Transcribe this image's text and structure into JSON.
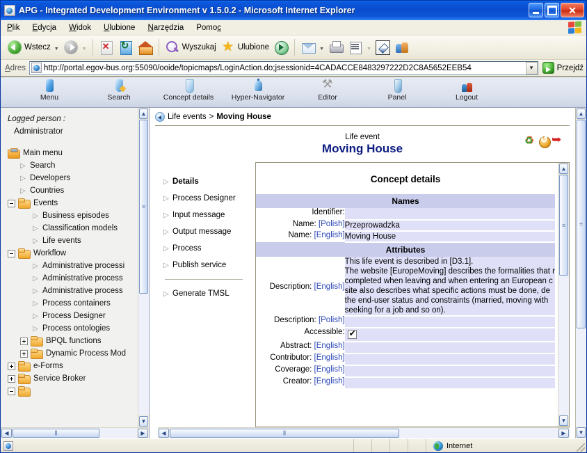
{
  "window": {
    "title": "APG - Integrated Development Environment v 1.5.0.2 - Microsoft Internet Explorer",
    "minimize_label": "Minimize",
    "maximize_label": "Maximize",
    "close_label": "Close"
  },
  "menubar": {
    "items": [
      {
        "label": "Plik",
        "accel": "P"
      },
      {
        "label": "Edycja",
        "accel": "E"
      },
      {
        "label": "Widok",
        "accel": "W"
      },
      {
        "label": "Ulubione",
        "accel": "U"
      },
      {
        "label": "Narzędzia",
        "accel": "N"
      },
      {
        "label": "Pomoc",
        "accel": "c"
      }
    ]
  },
  "toolbar": {
    "back_label": "Wstecz",
    "forward_label": "",
    "stop_label": "",
    "refresh_label": "",
    "home_label": "",
    "search_label": "Wyszukaj",
    "favorites_label": "Ulubione",
    "media_label": "",
    "mail_label": "",
    "print_label": "",
    "edit_label": "",
    "discuss_label": "",
    "messenger_label": ""
  },
  "address": {
    "label": "Adres",
    "url": "http://portal.egov-bus.org:55090/ooide/topicmaps/LoginAction.do;jsessionid=4CADACCE8483297222D2C8A5652EEB54",
    "go_label": "Przejdź"
  },
  "appnav": {
    "items": [
      {
        "label": "Menu",
        "icon": "menu-icon"
      },
      {
        "label": "Search",
        "icon": "search-icon"
      },
      {
        "label": "Concept details",
        "icon": "concept-details-icon"
      },
      {
        "label": "Hyper-Navigator",
        "icon": "hyper-navigator-icon"
      },
      {
        "label": "Editor",
        "icon": "editor-icon"
      },
      {
        "label": "Panel",
        "icon": "panel-icon"
      },
      {
        "label": "Logout",
        "icon": "logout-icon"
      }
    ]
  },
  "sidebar": {
    "logged_label": "Logged person :",
    "logged_user": "Administrator",
    "root": "Main menu",
    "tree": [
      {
        "label": "Search",
        "level": 2,
        "type": "leaf"
      },
      {
        "label": "Developers",
        "level": 2,
        "type": "leaf"
      },
      {
        "label": "Countries",
        "level": 2,
        "type": "leaf"
      },
      {
        "label": "Events",
        "level": 1,
        "type": "folder",
        "state": "expanded"
      },
      {
        "label": "Business episodes",
        "level": 3,
        "type": "leaf"
      },
      {
        "label": "Classification models",
        "level": 3,
        "type": "leaf"
      },
      {
        "label": "Life events",
        "level": 3,
        "type": "leaf"
      },
      {
        "label": "Workflow",
        "level": 1,
        "type": "folder",
        "state": "expanded"
      },
      {
        "label": "Administrative processi",
        "level": 3,
        "type": "leaf"
      },
      {
        "label": "Administrative process",
        "level": 3,
        "type": "leaf"
      },
      {
        "label": "Administrative process",
        "level": 3,
        "type": "leaf"
      },
      {
        "label": "Process containers",
        "level": 3,
        "type": "leaf"
      },
      {
        "label": "Process Designer",
        "level": 3,
        "type": "leaf"
      },
      {
        "label": "Process ontologies",
        "level": 3,
        "type": "leaf"
      },
      {
        "label": "BPQL functions",
        "level": 2,
        "type": "folder",
        "state": "collapsed"
      },
      {
        "label": "Dynamic Process Mod",
        "level": 2,
        "type": "folder",
        "state": "collapsed"
      },
      {
        "label": "e-Forms",
        "level": 1,
        "type": "folder",
        "state": "collapsed"
      },
      {
        "label": "Service Broker",
        "level": 1,
        "type": "folder",
        "state": "collapsed"
      }
    ]
  },
  "breadcrumb": {
    "parent": "Life events",
    "separator": ">",
    "current": "Moving House"
  },
  "page_title": {
    "subtitle": "Life event",
    "title": "Moving House",
    "actions": [
      {
        "name": "refresh-action-icon"
      },
      {
        "name": "history-action-icon"
      },
      {
        "name": "go-action-icon"
      }
    ]
  },
  "submenu": {
    "items": [
      {
        "label": "Details",
        "active": true
      },
      {
        "label": "Process Designer",
        "active": false
      },
      {
        "label": "Input message",
        "active": false
      },
      {
        "label": "Output message",
        "active": false
      },
      {
        "label": "Process",
        "active": false
      },
      {
        "label": "Publish service",
        "active": false
      }
    ],
    "extra": [
      {
        "label": "Generate TMSL",
        "active": false
      }
    ]
  },
  "details": {
    "title": "Concept details",
    "sections": [
      {
        "header": "Names",
        "rows": [
          {
            "label": "Identifier:",
            "lang": "",
            "value": "",
            "type": "text"
          },
          {
            "label": "Name:",
            "lang": "[Polish]",
            "value": "Przeprowadzka",
            "type": "text"
          },
          {
            "label": "Name:",
            "lang": "[English]",
            "value": "Moving House",
            "type": "text"
          }
        ]
      },
      {
        "header": "Attributes",
        "rows": [
          {
            "label": "Description:",
            "lang": "[English]",
            "value": "This life event is described in [D3.1].\nThe website [EuropeMoving] describes the formalities that r\ncompleted when leaving and when entering an European c\nsite also describes what specific actions must be done, de\nthe end-user status and constraints (married, moving with\nseeking for a job and so on).",
            "type": "multiline"
          },
          {
            "label": "Description:",
            "lang": "[Polish]",
            "value": "",
            "type": "text"
          },
          {
            "label": "Accessible:",
            "lang": "",
            "value": "checked",
            "type": "checkbox"
          },
          {
            "label": "Abstract:",
            "lang": "[English]",
            "value": "",
            "type": "text"
          },
          {
            "label": "Contributor:",
            "lang": "[English]",
            "value": "",
            "type": "text"
          },
          {
            "label": "Coverage:",
            "lang": "[English]",
            "value": "",
            "type": "text"
          },
          {
            "label": "Creator:",
            "lang": "[English]",
            "value": "",
            "type": "text"
          }
        ]
      }
    ]
  },
  "statusbar": {
    "message": "",
    "zone": "Internet"
  }
}
